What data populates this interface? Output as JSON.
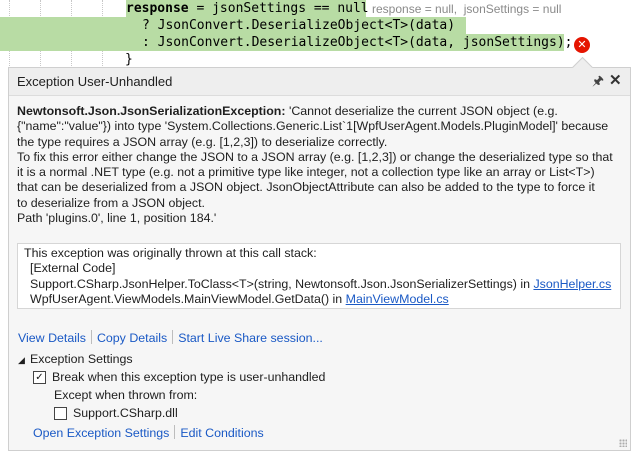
{
  "editor": {
    "line1_keyword": "response",
    "line1_rest": " = jsonSettings == null",
    "datatip": "response = null,  jsonSettings = null",
    "line2": "? JsonConvert.DeserializeObject<T>(data)",
    "line3": ": JsonConvert.DeserializeObject<T>(data, jsonSettings);",
    "line4": "}",
    "error_icon": "error-x-icon",
    "highlight_color": "#b8dca4"
  },
  "popup": {
    "title": "Exception User-Unhandled",
    "pin_icon": "pin-icon",
    "close_icon": "close-icon",
    "exception_name": "Newtonsoft.Json.JsonSerializationException:",
    "message_lines": [
      " 'Cannot deserialize the current JSON object (e.g.",
      "{\"name\":\"value\"}) into type 'System.Collections.Generic.List`1[WpfUserAgent.Models.PluginModel]' because",
      "the type requires a JSON array (e.g. [1,2,3]) to deserialize correctly.",
      "To fix this error either change the JSON to a JSON array (e.g. [1,2,3]) or change the deserialized type so that",
      "it is a normal .NET type (e.g. not a primitive type like integer, not a collection type like an array or List<T>)",
      "that can be deserialized from a JSON object. JsonObjectAttribute can also be added to the type to force it",
      "to deserialize from a JSON object.",
      "Path 'plugins.0', line 1, position 184.'"
    ],
    "stack": {
      "header": "This exception was originally thrown at this call stack:",
      "external": "[External Code]",
      "frame1_text": "Support.CSharp.JsonHelper.ToClass<T>(string, Newtonsoft.Json.JsonSerializerSettings) in ",
      "frame1_link": "JsonHelper.cs",
      "frame2_text": "WpfUserAgent.ViewModels.MainViewModel.GetData() in ",
      "frame2_link": "MainViewModel.cs"
    },
    "actions": {
      "view_details": "View Details",
      "copy_details": "Copy Details",
      "live_share": "Start Live Share session..."
    },
    "settings": {
      "header": "Exception Settings",
      "break_label": "Break when this exception type is user-unhandled",
      "break_checked": true,
      "except_label": "Except when thrown from:",
      "dll_label": "Support.CSharp.dll",
      "dll_checked": false
    },
    "bottom": {
      "open_settings": "Open Exception Settings",
      "edit_conditions": "Edit Conditions"
    },
    "link_color": "#1a59c5"
  }
}
